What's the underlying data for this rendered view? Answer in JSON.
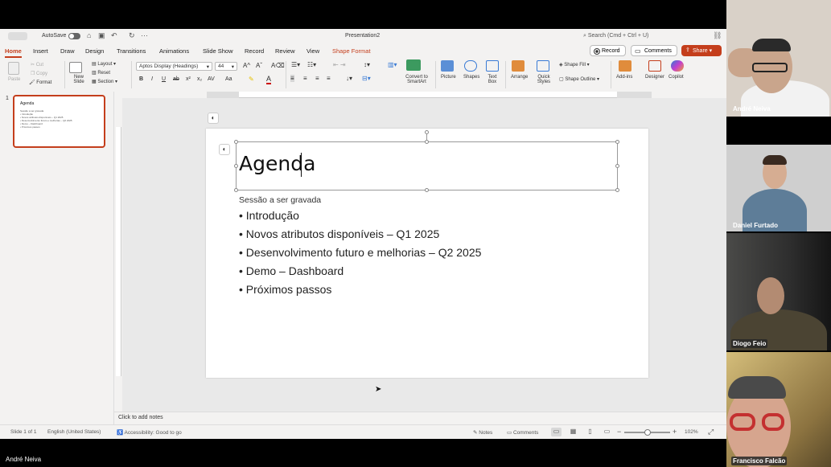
{
  "window": {
    "doc_title": "Presentation2",
    "autosave_label": "AutoSave",
    "search_placeholder": "Search (Cmd + Ctrl + U)"
  },
  "tabs": [
    "Home",
    "Insert",
    "Draw",
    "Design",
    "Transitions",
    "Animations",
    "Slide Show",
    "Record",
    "Review",
    "View",
    "Shape Format"
  ],
  "top_buttons": {
    "record": "Record",
    "comments": "Comments",
    "share": "Share"
  },
  "ribbon": {
    "paste": "Paste",
    "cut": "Cut",
    "copy": "Copy",
    "format": "Format",
    "new_slide": "New Slide",
    "layout": "Layout",
    "reset": "Reset",
    "section": "Section",
    "font_name": "Aptos Display (Headings)",
    "font_size": "44",
    "convert_smartart": "Convert to SmartArt",
    "picture": "Picture",
    "shapes": "Shapes",
    "text_box": "Text Box",
    "arrange": "Arrange",
    "quick_styles": "Quick Styles",
    "shape_fill": "Shape Fill",
    "shape_outline": "Shape Outline",
    "add_ins": "Add-ins",
    "designer": "Designer",
    "copilot": "Copilot"
  },
  "thumbnail": {
    "number": "1",
    "title": "Agenda",
    "lines": [
      "Sessão a ser gravada",
      "• Introdução",
      "• Novos atributos disponíveis – Q1 2025",
      "• Desenvolvimento futuro e melhorias – Q2 2025",
      "• Demo – Dashboard",
      "• Próximos passos"
    ]
  },
  "slide": {
    "title": "Agenda",
    "subtitle": "Sessão a ser gravada",
    "bullets": [
      "Introdução",
      "Novos atributos disponíveis – Q1 2025",
      "Desenvolvimento futuro e melhorias – Q2 2025",
      "Demo – Dashboard",
      "Próximos passos"
    ]
  },
  "notes_placeholder": "Click to add notes",
  "status": {
    "slide_count": "Slide 1 of 1",
    "language": "English (United States)",
    "accessibility": "Accessibility: Good to go",
    "notes": "Notes",
    "comments": "Comments",
    "zoom": "102%"
  },
  "presenter_name": "André Neiva",
  "participants": [
    "André Neiva",
    "Daniel Furtado",
    "Diogo Feio",
    "Francisco Falcão"
  ],
  "colors": {
    "accent": "#c43e1c"
  }
}
